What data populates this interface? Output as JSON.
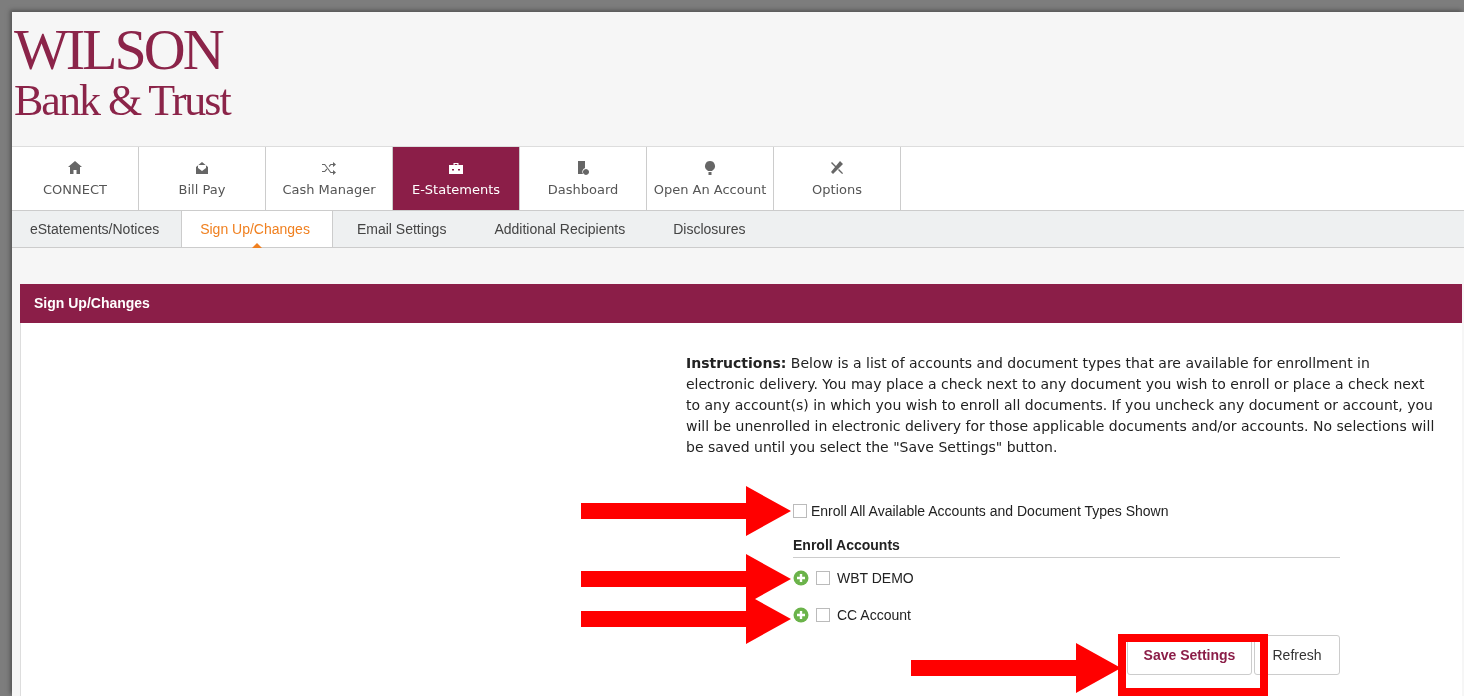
{
  "logo": {
    "line_1": "WILSON",
    "line_2": "Bank & Trust"
  },
  "main_tabs": [
    {
      "label": "CONNECT",
      "selected": false
    },
    {
      "label": "Bill Pay",
      "selected": false
    },
    {
      "label": "Cash Manager",
      "selected": false
    },
    {
      "label": "E-Statements",
      "selected": true
    },
    {
      "label": "Dashboard",
      "selected": false
    },
    {
      "label": "Open An Account",
      "selected": false
    },
    {
      "label": "Options",
      "selected": false
    }
  ],
  "sub_tabs": [
    {
      "label": "eStatements/Notices",
      "selected": false
    },
    {
      "label": "Sign Up/Changes",
      "selected": true
    },
    {
      "label": "Email Settings",
      "selected": false
    },
    {
      "label": "Additional Recipients",
      "selected": false
    },
    {
      "label": "Disclosures",
      "selected": false
    }
  ],
  "panel": {
    "title": "Sign Up/Changes",
    "instructions": "**Instructions:** Below is a list of accounts and document types that are available for enrollment in electronic delivery. You may place a check next to any document you wish to enroll or place a check next to any account(s) in which you wish to enroll all documents. If you uncheck any document or account, you will be unenrolled in electronic delivery for those applicable documents and/or accounts. No selections will be saved until you select the \"Save Settings\" button.",
    "enroll_all": {
      "label": "Enroll All Available Accounts and Document Types Shown",
      "checked": false
    },
    "accounts_heading": "Enroll Accounts",
    "accounts": [
      {
        "name": "WBT DEMO",
        "checked": false
      },
      {
        "name": "CC Account",
        "checked": false
      }
    ],
    "buttons": [
      {
        "label": "Save Settings",
        "kind": "primary"
      },
      {
        "label": "Refresh",
        "kind": "secondary"
      }
    ]
  }
}
